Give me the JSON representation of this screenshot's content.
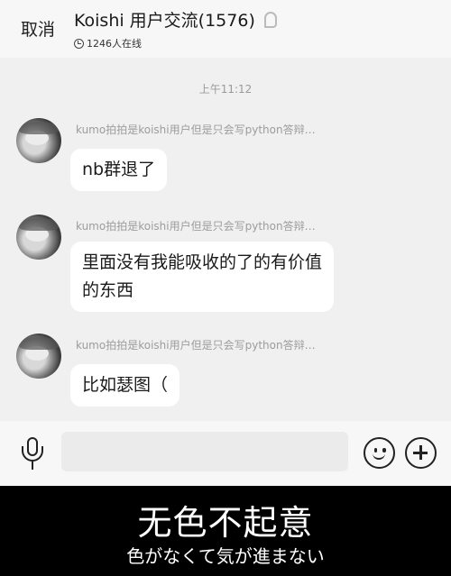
{
  "header": {
    "cancel_label": "取消",
    "title": "Koishi 用户交流(1576)",
    "online": "1246人在线"
  },
  "chat": {
    "time": "上午11:12",
    "messages": [
      {
        "sender": "kumo拍拍是koishi用户但是只会写python答辩…",
        "text_lines": [
          "nb群退了"
        ]
      },
      {
        "sender": "kumo拍拍是koishi用户但是只会写python答辩…",
        "text_lines": [
          "里面没有我能吸收的了的有价值",
          "的东西"
        ]
      },
      {
        "sender": "kumo拍拍是koishi用户但是只会写python答辩…",
        "text_lines": [
          "比如瑟图（"
        ]
      }
    ]
  },
  "input": {
    "icons": [
      "microphone-icon",
      "emoji-icon",
      "plus-icon"
    ]
  },
  "caption": {
    "main": "无色不起意",
    "sub": "色がなくて気が進まない"
  }
}
